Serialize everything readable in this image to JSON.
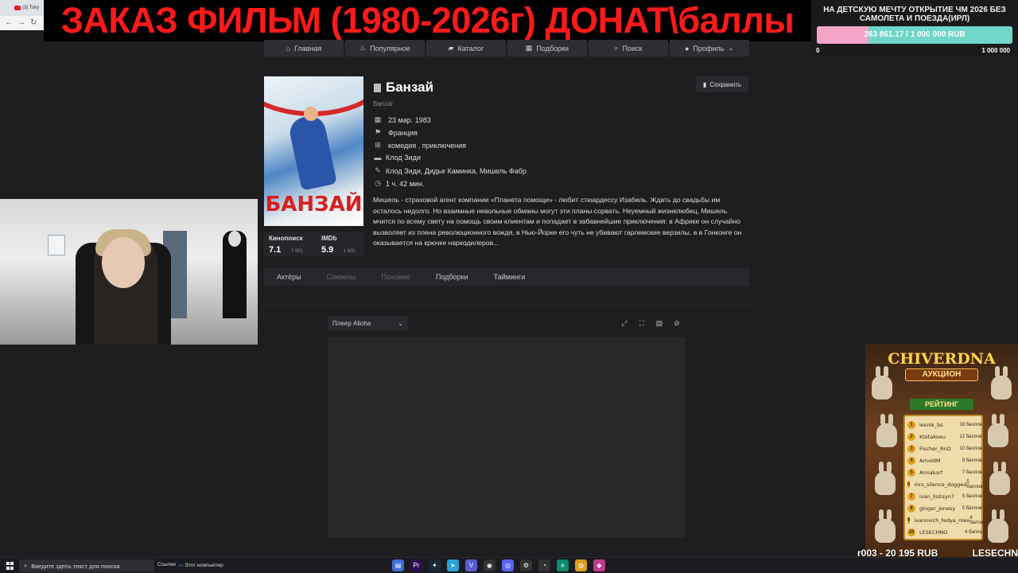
{
  "browser": {
    "tab_label": "(3) Toky",
    "nav_icons": [
      "back-arrow-icon",
      "forward-arrow-icon",
      "reload-icon"
    ]
  },
  "banner": {
    "text": "ЗАКАЗ ФИЛЬМ (1980-2026г) ДОНАТ\\баллы"
  },
  "goal": {
    "title": "НА ДЕТСКУЮ МЕЧТУ ОТКРЫТИЕ ЧМ 2026 БЕЗ САМОЛЕТА И ПОЕЗДА(ИРЛ)",
    "amount": "263 861.17 / 1 000 000 RUB",
    "progress_fraction": 0.264,
    "min": "0",
    "max": "1 000 000",
    "colors": {
      "fill": "#f6a3c8",
      "track": "#6fd6c8"
    }
  },
  "site_nav": [
    {
      "label": "Главная",
      "icon": "home-icon",
      "glyph": "⌂"
    },
    {
      "label": "Популярное",
      "icon": "fire-icon",
      "glyph": "♨"
    },
    {
      "label": "Каталог",
      "icon": "folder-icon",
      "glyph": "▰"
    },
    {
      "label": "Подборки",
      "icon": "collection-icon",
      "glyph": "▦"
    },
    {
      "label": "Поиск",
      "icon": "search-icon",
      "glyph": "⌕"
    },
    {
      "label": "Профиль",
      "icon": "profile-icon",
      "glyph": "●",
      "chevron": "⌄"
    }
  ],
  "film": {
    "title": "Банзай",
    "original_title": "Banzaï",
    "poster_text": "БАНЗАЙ",
    "save_label": "Сохранить",
    "release": "23 мар. 1983",
    "country": "Франция",
    "genres": "комедия ,  приключения",
    "director": "Клод Зиди",
    "writers": "Клод Зиди, Дидье Каминка, Мишель Фабр",
    "duration": "1 ч. 42 мин.",
    "description": "Мишель - страховой агент компании «Планета помощи» - любит стюардессу Изабель. Ждать до свадьбы им осталось недолго. Но взаимные невольные обманы могут эти планы сорвать. Неуемный жизнелюбец, Мишель мчится по всему свету на помощь своим клиентам и попадает в забавнейшие приключения: в Африке он случайно вызволяет из плена революционного вождя, в Нью-Йорке его чуть не убивают гарлемские верзилы, а в Гонконге он оказывается на крючке наркодилеров...",
    "ratings": [
      {
        "source": "Кинопоиск",
        "value": "7.1",
        "votes": "7 901"
      },
      {
        "source": "IMDb",
        "value": "5.9",
        "votes": "1 900"
      }
    ]
  },
  "tabs": [
    {
      "label": "Актёры",
      "active": true
    },
    {
      "label": "Сиквелы",
      "active": false
    },
    {
      "label": "Похожие",
      "active": false
    },
    {
      "label": "Подборки",
      "active": true
    },
    {
      "label": "Тайминги",
      "active": true
    }
  ],
  "player": {
    "selected": "Плеер Alloha",
    "tools": [
      "expand-icon",
      "fullscreen-icon",
      "comment-icon",
      "link-icon"
    ]
  },
  "auction": {
    "brand": "CHIVERDNA",
    "subtitle": "АУКЦИОН",
    "rating_label": "РЕЙТИНГ",
    "rows": [
      {
        "rank": "1",
        "name": "lesnik_bs",
        "points": "18 баллов"
      },
      {
        "rank": "2",
        "name": "Ktotakoeu",
        "points": "12 баллов"
      },
      {
        "rank": "3",
        "name": "Fischer_RnD",
        "points": "10 баллов"
      },
      {
        "rank": "4",
        "name": "ArnoldM",
        "points": "9 баллов"
      },
      {
        "rank": "5",
        "name": "Annakorf",
        "points": "7 баллов"
      },
      {
        "rank": "6",
        "name": "mrs_silence_dogged",
        "points": "5 баллов"
      },
      {
        "rank": "7",
        "name": "ivan_lisitsyn7",
        "points": "5 баллов"
      },
      {
        "rank": "8",
        "name": "ginger_jonesy",
        "points": "5 баллов"
      },
      {
        "rank": "9",
        "name": "ivanovich_fedya_mex",
        "points": "4 балла"
      },
      {
        "rank": "10",
        "name": "LESECHNO",
        "points": "4 балла"
      }
    ],
    "footer_left": "r003 - 20 195 RUB",
    "footer_right": "LESECHN"
  },
  "taskbar": {
    "search_placeholder": "Введите здесь текст для поиска",
    "links_label": "Ссылки",
    "pc_label": "Этот компьютер",
    "apps": [
      {
        "name": "file-explorer-icon",
        "glyph": "▤",
        "color": "#3b6fd6"
      },
      {
        "name": "premiere-icon",
        "glyph": "Pr",
        "color": "#2a1050"
      },
      {
        "name": "steam-icon",
        "glyph": "✦",
        "color": "#1b2838"
      },
      {
        "name": "telegram-icon",
        "glyph": "➤",
        "color": "#2aa1da"
      },
      {
        "name": "vpn-icon",
        "glyph": "V",
        "color": "#5a5ad0"
      },
      {
        "name": "obs-icon",
        "glyph": "◉",
        "color": "#333"
      },
      {
        "name": "discord-icon",
        "glyph": "◎",
        "color": "#5865f2"
      },
      {
        "name": "settings-icon",
        "glyph": "⚙",
        "color": "#333"
      },
      {
        "name": "clock-icon",
        "glyph": "◔",
        "color": "#333"
      },
      {
        "name": "edge-icon",
        "glyph": "e",
        "color": "#0c8a6c"
      },
      {
        "name": "chrome-icon",
        "glyph": "◍",
        "color": "#d9a020"
      },
      {
        "name": "app-icon",
        "glyph": "◆",
        "color": "#c03a8a"
      }
    ]
  }
}
